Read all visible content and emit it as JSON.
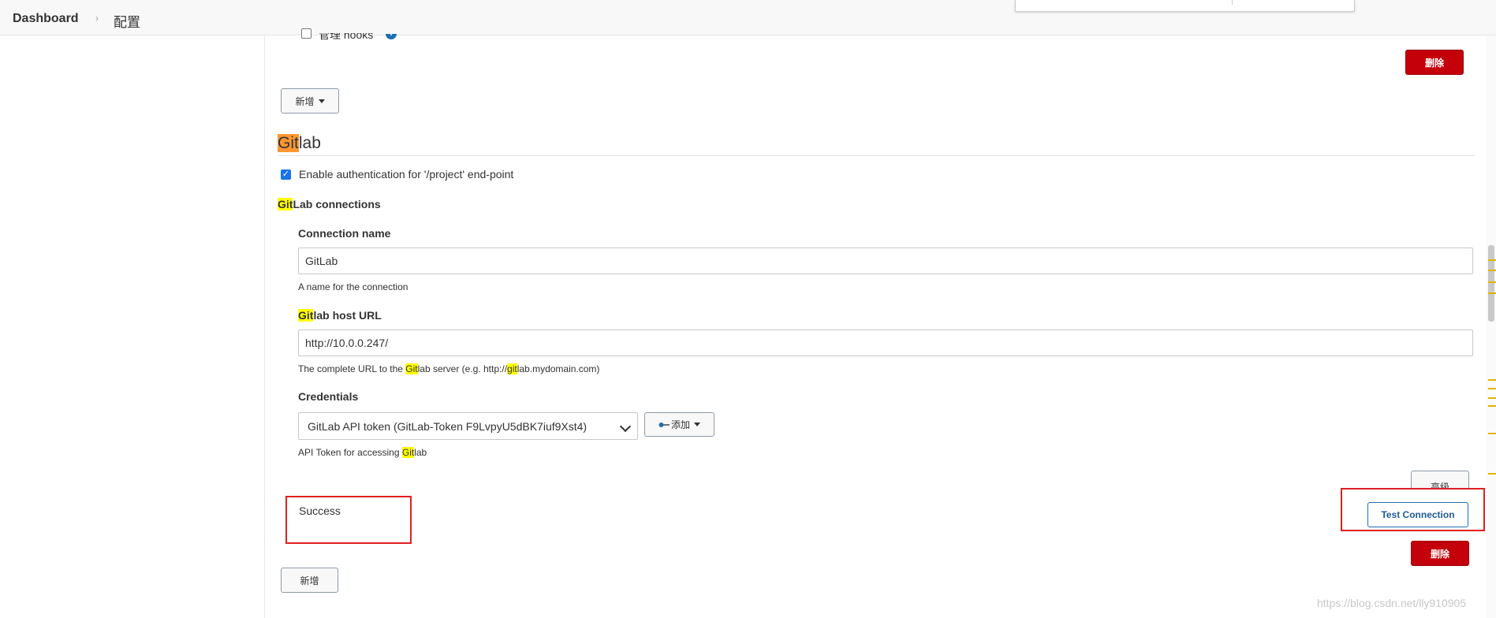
{
  "breadcrumb": {
    "dashboard": "Dashboard",
    "config": "配置"
  },
  "top": {
    "hooks_label_partial": "管理 hooks",
    "info": "i"
  },
  "buttons": {
    "delete_top": "删除",
    "add_top": "新增",
    "advanced": "高级",
    "test_connection": "Test Connection",
    "delete_bottom": "删除",
    "add_bottom": "新增",
    "add_credentials": "添加"
  },
  "gitlab": {
    "title_hl": "Git",
    "title_rest": "lab",
    "enable_auth_label": "Enable authentication for '/project' end-point",
    "enable_auth_checked": true,
    "connections_hl": "Git",
    "connections_rest": "Lab connections",
    "connection_name_label": "Connection name",
    "connection_name_value": "GitLab",
    "connection_name_help": "A name for the connection",
    "host_label_hl": "Git",
    "host_label_rest": "lab host URL",
    "host_value": "http://10.0.0.247/",
    "host_help_1": "The complete URL to the ",
    "host_help_hl1": "Git",
    "host_help_2": "lab server (e.g. http://",
    "host_help_hl2": "git",
    "host_help_3": "lab.mydomain.com)",
    "credentials_label": "Credentials",
    "credentials_value": "GitLab API token (GitLab-Token F9LvpyU5dBK7iuf9Xst4)",
    "credentials_help_1": "API Token for accessing ",
    "credentials_help_hl": "Git",
    "credentials_help_2": "lab",
    "status": "Success"
  },
  "watermark": "https://blog.csdn.net/lly910905",
  "colors": {
    "danger": "#c4000a",
    "primary": "#1f6fb5",
    "highlight": "#ffff00",
    "highlight_current": "#ff9632"
  }
}
